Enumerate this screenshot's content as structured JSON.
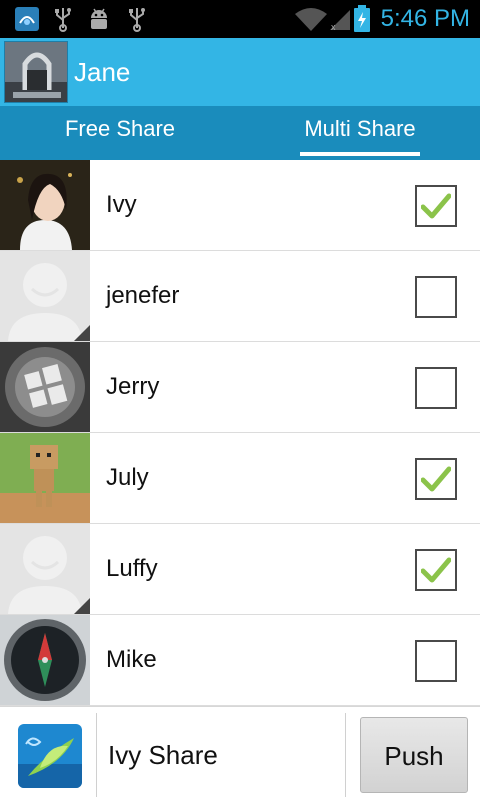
{
  "status_bar": {
    "time": "5:46 PM",
    "icons": [
      "app-notification-icon",
      "usb-icon",
      "android-debug-icon",
      "usb-icon",
      "wifi-icon",
      "signal-icon",
      "battery-charging-icon"
    ],
    "accent_color": "#33b5e5"
  },
  "header": {
    "user_name": "Jane",
    "background_color": "#33b5e5"
  },
  "tabs": [
    {
      "label": "Free Share",
      "selected": false
    },
    {
      "label": "Multi Share",
      "selected": true
    }
  ],
  "contacts": [
    {
      "name": "Ivy",
      "checked": true,
      "photo": "woman-portrait"
    },
    {
      "name": "jenefer",
      "checked": false,
      "photo": "default-avatar"
    },
    {
      "name": "Jerry",
      "checked": false,
      "photo": "windows-logo-keycap"
    },
    {
      "name": "July",
      "checked": true,
      "photo": "cardboard-robot"
    },
    {
      "name": "Luffy",
      "checked": true,
      "photo": "default-avatar"
    },
    {
      "name": "Mike",
      "checked": false,
      "photo": "compass"
    }
  ],
  "bottom_bar": {
    "app_name": "Ivy Share",
    "push_label": "Push"
  }
}
